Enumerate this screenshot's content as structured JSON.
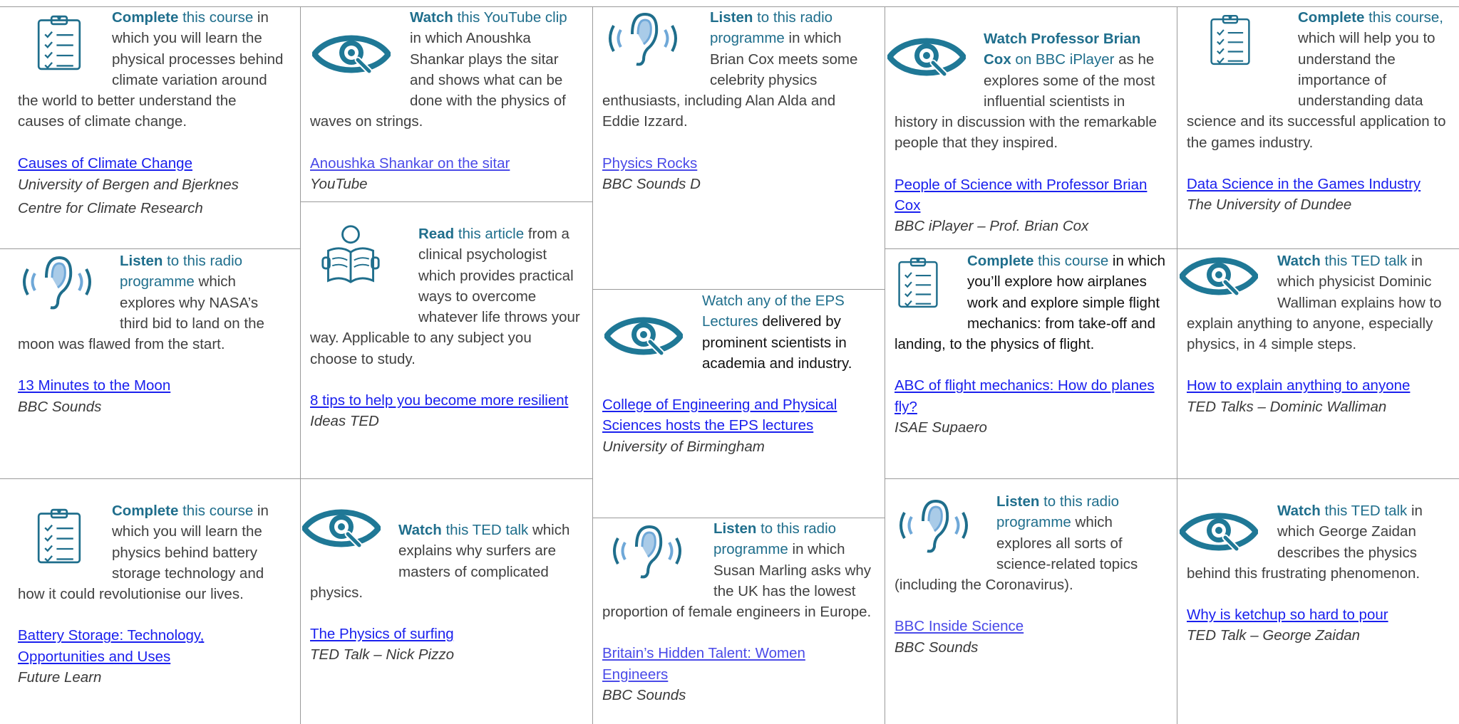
{
  "colors": {
    "accent": "#1f6e8c",
    "link": "#1a20ee",
    "text": "#404040",
    "grid": "#9a9a9a"
  },
  "cards": [
    {
      "id": "c1",
      "icon": "clipboard-icon",
      "verb": "Complete",
      "verb_rest": " this course",
      "body_hl": "",
      "body": " in which you will learn the physical processes behind climate variation around the world to better understand the causes of climate change.",
      "link": "Causes of Climate Change",
      "source": "University of Bergen and Bjerknes Centre for Climate Research"
    },
    {
      "id": "c2",
      "icon": "ear-icon",
      "verb": "Listen",
      "verb_rest": " to this radio programme",
      "body": " which explores why NASA’s third bid to land on the moon was flawed from the start.",
      "link": "13 Minutes to the Moon",
      "source": "BBC Sounds"
    },
    {
      "id": "c3",
      "icon": "clipboard-icon",
      "verb": "Complete",
      "verb_rest": " this course",
      "body": " in which you will learn the physics behind battery storage technology and how it could revolutionise our lives.",
      "link": "Battery Storage: Technology, Opportunities and Uses",
      "source": "Future Learn"
    },
    {
      "id": "c4",
      "icon": "eye-icon",
      "verb": "Watch",
      "verb_rest": " this YouTube clip",
      "body": " in which Anoushka Shankar plays the sitar and shows what can be done with the physics of waves on strings.",
      "link": "Anoushka Shankar on the sitar",
      "source": "YouTube"
    },
    {
      "id": "c5",
      "icon": "reader-icon",
      "verb": "Read",
      "verb_rest": " this article",
      "body": " from a clinical psychologist which provides practical ways to overcome whatever life throws your way. Applicable to any subject you choose to study.",
      "link": "8 tips to help you become more resilient",
      "source": "Ideas TED"
    },
    {
      "id": "c6",
      "icon": "eye-icon",
      "verb": "Watch",
      "verb_rest": " this TED talk",
      "body": " which explains why surfers are masters of complicated physics.",
      "link": "The Physics of surfing",
      "source": "TED Talk – Nick Pizzo"
    },
    {
      "id": "c7",
      "icon": "ear-icon",
      "verb": "Listen",
      "verb_rest": " to this radio programme",
      "body": " in which Brian Cox meets some celebrity physics enthusiasts, including Alan Alda and Eddie Izzard.",
      "link": "Physics Rocks",
      "source": "BBC Sounds D"
    },
    {
      "id": "c8",
      "icon": "eye-icon",
      "verb": "Watch",
      "verb_rest": " any of the EPS Lectures",
      "body": " delivered by prominent scientists in academia and industry.",
      "link": "College of Engineering and Physical Sciences hosts the EPS lectures",
      "source": "University of Birmingham"
    },
    {
      "id": "c9",
      "icon": "ear-icon",
      "verb": "Listen",
      "verb_rest": " to this radio programme",
      "body": " in which Susan Marling asks why the UK has the lowest proportion of female engineers in Europe.",
      "link": "Britain’s Hidden Talent: Women Engineers",
      "source": "BBC Sounds"
    },
    {
      "id": "c10",
      "icon": "eye-icon",
      "verb": "Watch Professor Brian Cox",
      "verb_rest": " on BBC iPlayer",
      "body": " as he explores some of the most influential scientists in history in discussion with the remarkable people that they inspired.",
      "link": "People of Science with Professor Brian Cox",
      "source": "BBC iPlayer – Prof. Brian Cox"
    },
    {
      "id": "c11",
      "icon": "clipboard-icon",
      "verb": "Complete",
      "verb_rest": " this course",
      "body": " in which you’ll explore how airplanes work and explore simple flight mechanics: from take-off and landing, to the physics of flight.",
      "link": "ABC of flight mechanics: How do planes fly?",
      "source": "ISAE Supaero"
    },
    {
      "id": "c12",
      "icon": "ear-icon",
      "verb": "Listen",
      "verb_rest": " to this radio programme",
      "body": " which explores all sorts of science-related topics (including the Coronavirus).",
      "link": "BBC Inside Science",
      "source": "BBC Sounds"
    },
    {
      "id": "c13",
      "icon": "clipboard-icon",
      "verb": "Complete",
      "verb_rest": " this course,",
      "body": " which will help you to understand the importance of understanding data science and its successful application to the games industry.",
      "link": "Data Science in the Games Industry",
      "source": "The University of Dundee"
    },
    {
      "id": "c14",
      "icon": "eye-icon",
      "verb": "Watch",
      "verb_rest": " this TED talk",
      "body": " in which physicist Dominic Walliman explains how to explain anything to anyone, especially physics, in 4 simple steps.",
      "link": "How to explain anything to anyone",
      "source": "TED Talks – Dominic Walliman"
    },
    {
      "id": "c15",
      "icon": "eye-icon",
      "verb": "Watch",
      "verb_rest": " this TED talk",
      "body": " in which George Zaidan describes the physics behind this frustrating phenomenon.",
      "link": "Why is ketchup so hard to pour",
      "source": "TED Talk – George Zaidan"
    }
  ]
}
